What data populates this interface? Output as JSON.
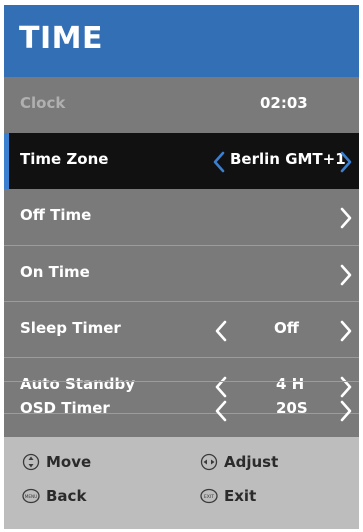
{
  "header": {
    "title": "TIME"
  },
  "rows": [
    {
      "label": "Clock",
      "value": "02:03"
    },
    {
      "label": "Time Zone",
      "value": "Berlin GMT+1"
    },
    {
      "label": "Off Time"
    },
    {
      "label": "On Time"
    },
    {
      "label": "Sleep Timer",
      "value": "Off"
    },
    {
      "label": "Auto Standby",
      "value": "4 H"
    },
    {
      "label": "OSD Timer",
      "value": "20S"
    }
  ],
  "footer": {
    "move": "Move",
    "adjust": "Adjust",
    "back": "Back",
    "exit": "Exit",
    "back_key": "MENU",
    "exit_key": "EXIT"
  },
  "colors": {
    "header": "#336fb5",
    "accent": "#3b7fd1",
    "panel": "#7a7a7a",
    "selected": "#111111",
    "footer": "#bdbdbd"
  }
}
